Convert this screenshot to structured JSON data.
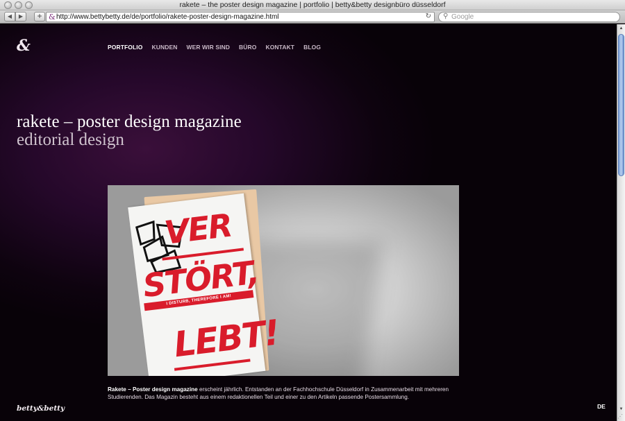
{
  "window": {
    "title": "rakete – the poster design magazine | portfolio | betty&betty designbüro düsseldorf"
  },
  "toolbar": {
    "back_icon": "back-arrow-icon",
    "forward_icon": "forward-arrow-icon",
    "add_bookmark_label": "+",
    "url": "http://www.bettybetty.de/de/portfolio/rakete-poster-design-magazine.html",
    "search_placeholder": "Google"
  },
  "site": {
    "logo_glyph": "&",
    "footer_logo": "betty&betty",
    "language": "DE",
    "nav": [
      {
        "label": "PORTFOLIO",
        "active": true
      },
      {
        "label": "KUNDEN",
        "active": false
      },
      {
        "label": "WER WIR SIND",
        "active": false
      },
      {
        "label": "BÜRO",
        "active": false
      },
      {
        "label": "KONTAKT",
        "active": false
      },
      {
        "label": "BLOG",
        "active": false
      }
    ]
  },
  "project": {
    "title": "rakete – poster design magazine",
    "subtitle": "editorial design",
    "caption_bold": "Rakete – Poster design magazine",
    "caption_rest": " erscheint jährlich. Entstanden an der Fachhochschule Düsseldorf in Zusammenarbeit mit mehreren Studierenden. Das Magazin besteht aus einem redaktionellen Teil und einer zu den Artikeln passende Postersammlung."
  },
  "cover": {
    "line1": "VER",
    "line2": "STÖRT,",
    "band": "I DISTURB, THEREFORE I AM!",
    "line3": "LEBT!"
  },
  "colors": {
    "accent_red": "#d91c2b",
    "background": "#0a0208",
    "bg_glow": "#3a0f3a"
  }
}
